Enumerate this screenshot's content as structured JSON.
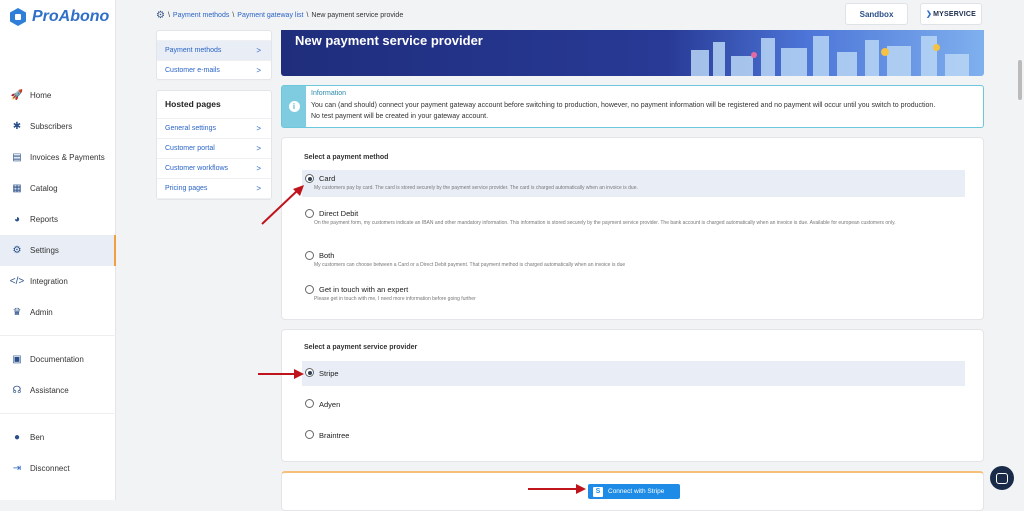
{
  "app": {
    "name": "ProAbono"
  },
  "sidebar": {
    "items": [
      {
        "label": "Home",
        "icon": "rocket-icon"
      },
      {
        "label": "Subscribers",
        "icon": "subscribers-icon"
      },
      {
        "label": "Invoices & Payments",
        "icon": "invoice-icon"
      },
      {
        "label": "Catalog",
        "icon": "catalog-icon"
      },
      {
        "label": "Reports",
        "icon": "pie-chart-icon"
      },
      {
        "label": "Settings",
        "icon": "gears-icon",
        "active": true
      },
      {
        "label": "Integration",
        "icon": "code-icon"
      },
      {
        "label": "Admin",
        "icon": "crown-icon"
      },
      {
        "label": "Documentation",
        "icon": "book-icon"
      },
      {
        "label": "Assistance",
        "icon": "headset-icon"
      },
      {
        "label": "Ben",
        "icon": "user-icon"
      },
      {
        "label": "Disconnect",
        "icon": "logout-icon"
      }
    ]
  },
  "topbar": {
    "breadcrumb": [
      "Payment methods",
      "Payment gateway list",
      "New payment service provide"
    ],
    "separator": "\\",
    "sandbox": "Sandbox",
    "brand": "MYSERVICE"
  },
  "settings_nav": {
    "group1": [
      {
        "label": "Payment methods",
        "selected": true
      },
      {
        "label": "Customer e-mails"
      }
    ],
    "hosted_title": "Hosted pages",
    "group2": [
      {
        "label": "General settings"
      },
      {
        "label": "Customer portal"
      },
      {
        "label": "Customer workflows"
      },
      {
        "label": "Pricing pages"
      }
    ],
    "arrow": ">"
  },
  "banner": {
    "title": "New payment service provider"
  },
  "info": {
    "title": "Information",
    "line1": "You can (and should) connect your payment gateway account before switching to production, however, no payment information will be registered and no payment will occur until you switch to production.",
    "line2": "No test payment will be created in your gateway account."
  },
  "payment_method": {
    "title": "Select a payment method",
    "options": [
      {
        "label": "Card",
        "desc": "My customers pay by card. The card is stored securely by the payment service provider. The card is charged automatically when an invoice is due.",
        "selected": true
      },
      {
        "label": "Direct Debit",
        "desc": "On the payment form, my customers indicate an IBAN and other mandatory information. This information is stored securely by the payment service provider. The bank account is charged automatically when an invoice is due. Available for european customers only.",
        "selected": false
      },
      {
        "label": "Both",
        "desc": "My customers can choose between a Card or a Direct Debit payment. That payment method is charged automatically when an invoice is due",
        "selected": false
      },
      {
        "label": "Get in touch with an expert",
        "desc": "Please get in touch with me, I need more information before going further",
        "selected": false
      }
    ]
  },
  "provider": {
    "title": "Select a payment service provider",
    "options": [
      {
        "label": "Stripe",
        "selected": true
      },
      {
        "label": "Adyen",
        "selected": false
      },
      {
        "label": "Braintree",
        "selected": false
      }
    ]
  },
  "connect": {
    "label": "Connect with Stripe",
    "icon_letter": "S"
  },
  "colors": {
    "accent": "#2a64c6",
    "arrow": "#c0141c",
    "stripe": "#1e8ce6"
  }
}
